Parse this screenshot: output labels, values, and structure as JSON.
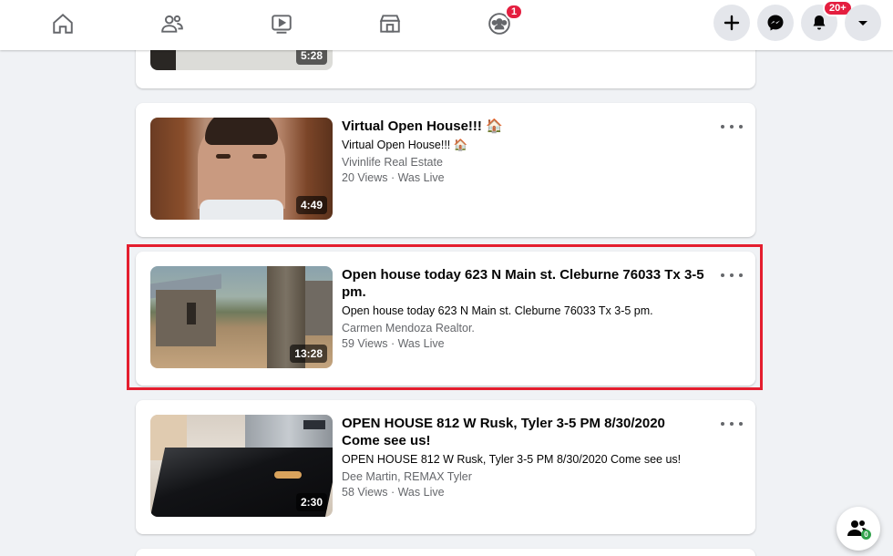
{
  "nav": {
    "tabs": [
      {
        "name": "home-icon"
      },
      {
        "name": "friends-icon"
      },
      {
        "name": "watch-icon"
      },
      {
        "name": "marketplace-icon"
      },
      {
        "name": "groups-icon",
        "badge": "1"
      }
    ],
    "notifications_badge": "20+"
  },
  "videos": [
    {
      "duration": "5:28"
    },
    {
      "title": "Virtual Open House!!! 🏠",
      "description": "Virtual Open House!!! 🏠",
      "author": "Vivinlife Real Estate",
      "meta": "20 Views · Was Live",
      "duration": "4:49"
    },
    {
      "title": "Open house today 623 N Main st. Cleburne 76033 Tx 3-5 pm.",
      "description": "Open house today 623 N Main st. Cleburne 76033 Tx 3-5 pm.",
      "author": "Carmen Mendoza Realtor.",
      "meta": "59 Views · Was Live",
      "duration": "13:28"
    },
    {
      "title": "OPEN HOUSE 812 W Rusk, Tyler 3-5 PM 8/30/2020 Come see us!",
      "description": "OPEN HOUSE 812 W Rusk, Tyler 3-5 PM 8/30/2020 Come see us!",
      "author": "Dee Martin, REMAX Tyler",
      "meta": "58 Views · Was Live",
      "duration": "2:30"
    }
  ],
  "contacts_badge": "0",
  "colors": {
    "accent": "#1877f2",
    "badge": "#e41e3f",
    "highlight": "#e41e2e"
  }
}
